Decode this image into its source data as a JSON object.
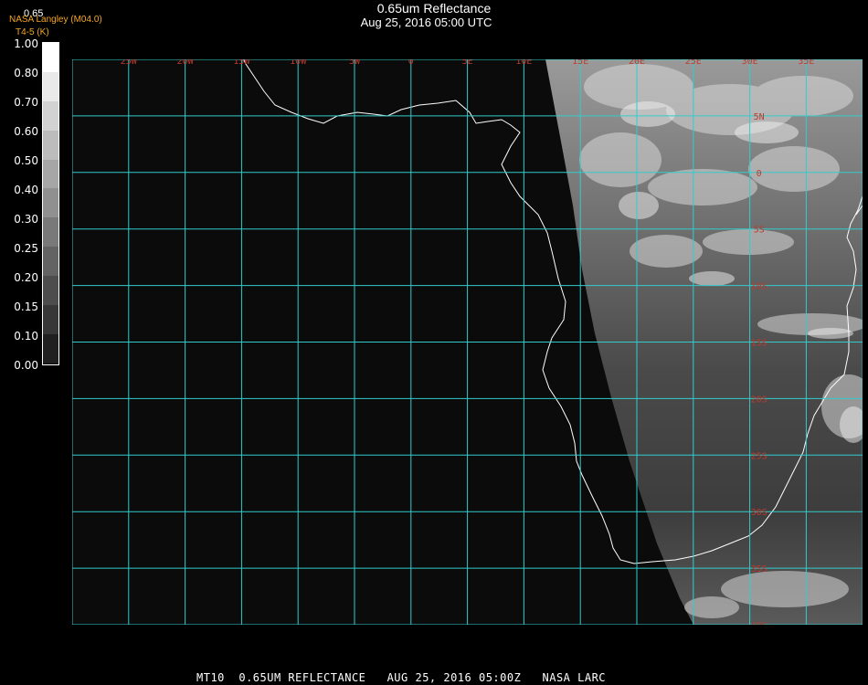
{
  "header": {
    "title": "0.65um Reflectance",
    "datetime": "Aug 25, 2016 05:00 UTC",
    "credit": "NASA Langley (M04.0)",
    "band_label": "T4-5 (K)",
    "scale_top": "0.65"
  },
  "colorbar": {
    "ticks": [
      "1.00",
      "0.80",
      "0.70",
      "0.60",
      "0.50",
      "0.40",
      "0.30",
      "0.25",
      "0.20",
      "0.15",
      "0.10",
      "0.00"
    ]
  },
  "map": {
    "lon_labels": [
      "25W",
      "20W",
      "15W",
      "10W",
      "5W",
      "0",
      "5E",
      "10E",
      "15E",
      "20E",
      "25E",
      "30E",
      "35E"
    ],
    "lat_labels": [
      "5N",
      "0",
      "5S",
      "10S",
      "15S",
      "20S",
      "25S",
      "30S",
      "35S",
      "40S"
    ],
    "grid_color": "#33cccc",
    "label_color": "#c0392b",
    "coast_color": "#ffffff"
  },
  "footer": {
    "text": "MT10  0.65UM REFLECTANCE   AUG 25, 2016 05:00Z   NASA LARC"
  }
}
